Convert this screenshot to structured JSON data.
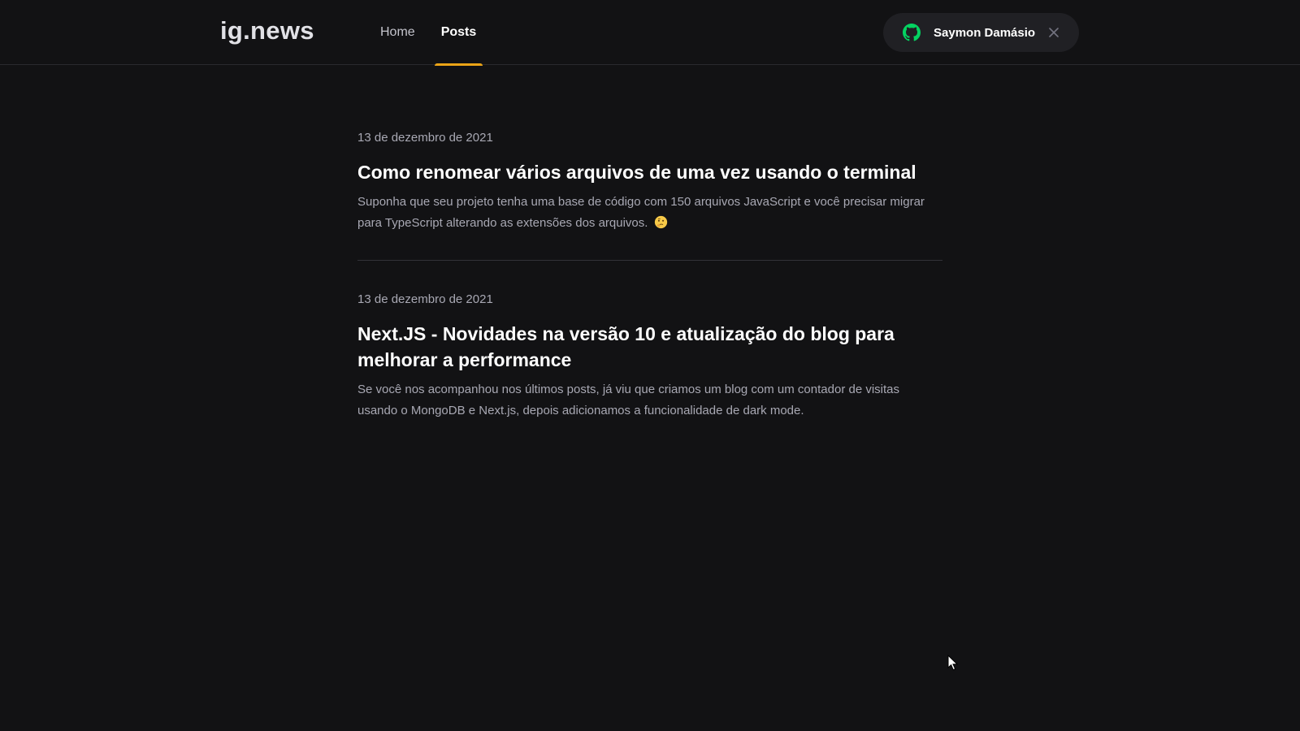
{
  "header": {
    "logo": "ig.news",
    "nav": [
      {
        "label": "Home",
        "active": false
      },
      {
        "label": "Posts",
        "active": true
      }
    ],
    "user": {
      "name": "Saymon Damásio",
      "icon": "github-icon",
      "close_icon": "close-icon"
    }
  },
  "posts": [
    {
      "date": "13 de dezembro de 2021",
      "title": "Como renomear vários arquivos de uma vez usando o terminal",
      "excerpt": "Suponha que seu projeto tenha uma base de código com 150 arquivos JavaScript e você precisar migrar para TypeScript alterando as extensões dos arquivos.",
      "emoji": "thinking-face-icon"
    },
    {
      "date": "13 de dezembro de 2021",
      "title": "Next.JS - Novidades na versão 10 e atualização do blog para melhorar a performance",
      "excerpt": "Se você nos acompanhou nos últimos posts, já viu que criamos um blog com um contador de visitas usando o MongoDB e Next.js, depois adicionamos a funcionalidade de dark mode."
    }
  ],
  "colors": {
    "background": "#121214",
    "accent": "#eba417",
    "github_green": "#04d361",
    "user_button_bg": "#202024"
  }
}
